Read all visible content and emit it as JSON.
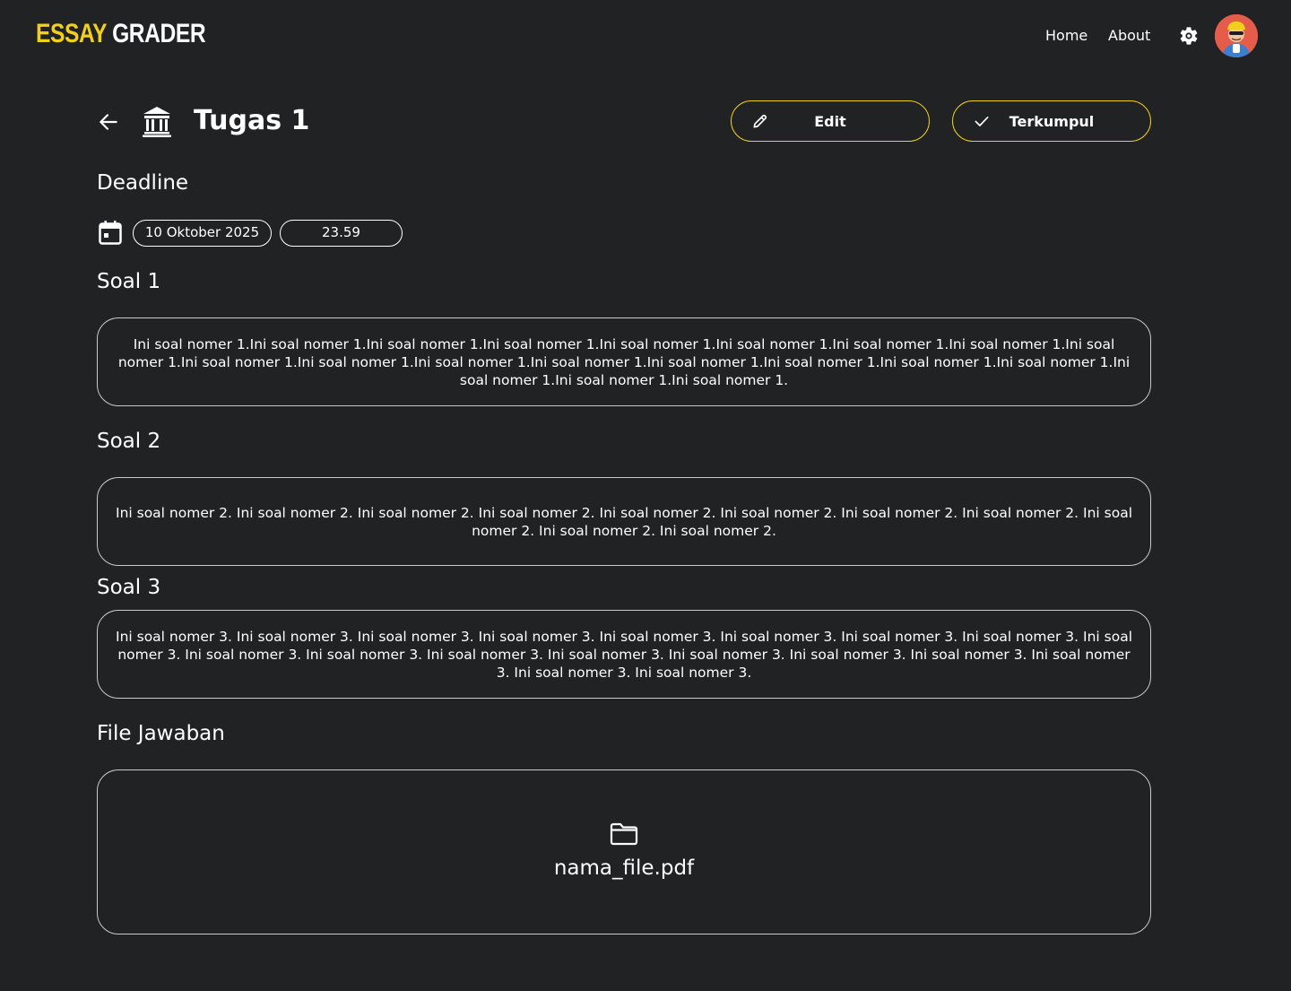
{
  "app": {
    "logo_part1": "ESSAY",
    "logo_part2": "GRADER",
    "accent_color": "#f2cf1e",
    "background_color": "#212224"
  },
  "nav": {
    "items": [
      {
        "label": "Home"
      },
      {
        "label": "About"
      }
    ],
    "settings_icon": "gear-icon",
    "avatar_icon": "user-avatar"
  },
  "header": {
    "back_icon": "arrow-left-icon",
    "title_icon": "bank-icon",
    "title": "Tugas 1",
    "edit_label": "Edit",
    "edit_icon": "pencil-icon",
    "status_label": "Terkumpul",
    "status_icon": "check-icon"
  },
  "deadline": {
    "label": "Deadline",
    "icon": "calendar-icon",
    "date": "10 Oktober 2025",
    "time": "23.59"
  },
  "questions": [
    {
      "label": "Soal 1",
      "text": "Ini soal nomer 1.Ini soal nomer 1.Ini soal nomer 1.Ini soal nomer 1.Ini soal nomer 1.Ini soal nomer 1.Ini soal nomer 1.Ini soal nomer 1.Ini soal nomer 1.Ini soal nomer 1.Ini soal nomer 1.Ini soal nomer 1.Ini soal nomer 1.Ini soal nomer 1.Ini soal nomer 1.Ini soal nomer 1.Ini soal nomer 1.Ini soal nomer 1.Ini soal nomer 1.Ini soal nomer 1."
    },
    {
      "label": "Soal 2",
      "text": "Ini soal nomer 2. Ini soal nomer 2. Ini soal nomer 2. Ini soal nomer 2. Ini soal nomer 2. Ini soal nomer 2. Ini soal nomer 2. Ini soal nomer 2. Ini soal nomer 2. Ini soal nomer 2. Ini soal nomer 2."
    },
    {
      "label": "Soal 3",
      "text": "Ini soal nomer 3. Ini soal nomer 3. Ini soal nomer 3. Ini soal nomer 3. Ini soal nomer 3. Ini soal nomer 3. Ini soal nomer 3. Ini soal nomer 3. Ini soal nomer 3. Ini soal nomer 3. Ini soal nomer 3. Ini soal nomer 3. Ini soal nomer 3. Ini soal nomer 3. Ini soal nomer 3. Ini soal nomer 3. Ini soal nomer 3. Ini soal nomer 3. Ini soal nomer 3."
    }
  ],
  "answer_file": {
    "label": "File Jawaban",
    "icon": "folder-icon",
    "file_name": "nama_file.pdf"
  }
}
